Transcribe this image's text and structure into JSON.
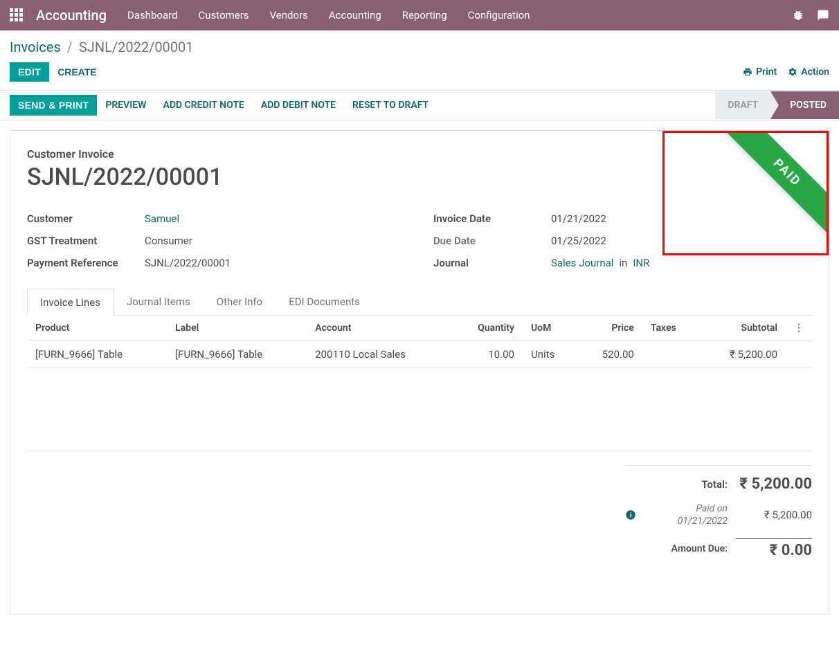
{
  "topnav": {
    "app_title": "Accounting",
    "items": [
      "Dashboard",
      "Customers",
      "Vendors",
      "Accounting",
      "Reporting",
      "Configuration"
    ]
  },
  "breadcrumb": {
    "root": "Invoices",
    "current": "SJNL/2022/00001"
  },
  "controls": {
    "edit": "Edit",
    "create": "Create",
    "print": "Print",
    "action": "Action"
  },
  "strip": {
    "send_print": "Send & Print",
    "preview": "Preview",
    "credit": "Add Credit Note",
    "debit": "Add Debit Note",
    "reset": "Reset to Draft"
  },
  "status": {
    "draft": "DRAFT",
    "posted": "POSTED"
  },
  "ribbon": "PAID",
  "invoice": {
    "subtitle": "Customer Invoice",
    "title": "SJNL/2022/00001",
    "fields_left": {
      "customer_label": "Customer",
      "customer_value": "Samuel",
      "gst_label": "GST Treatment",
      "gst_value": "Consumer",
      "payref_label": "Payment Reference",
      "payref_value": "SJNL/2022/00001"
    },
    "fields_right": {
      "invdate_label": "Invoice Date",
      "invdate_value": "01/21/2022",
      "duedate_label": "Due Date",
      "duedate_value": "01/25/2022",
      "journal_label": "Journal",
      "journal_value": "Sales Journal",
      "journal_in": "in",
      "journal_cur": "INR"
    }
  },
  "tabs": [
    "Invoice Lines",
    "Journal Items",
    "Other Info",
    "EDI Documents"
  ],
  "table": {
    "headers": {
      "product": "Product",
      "label": "Label",
      "account": "Account",
      "quantity": "Quantity",
      "uom": "UoM",
      "price": "Price",
      "taxes": "Taxes",
      "subtotal": "Subtotal"
    },
    "rows": [
      {
        "product": "[FURN_9666] Table",
        "label": "[FURN_9666] Table",
        "account": "200110 Local Sales",
        "quantity": "10.00",
        "uom": "Units",
        "price": "520.00",
        "taxes": "",
        "subtotal": "₹ 5,200.00"
      }
    ]
  },
  "totals": {
    "total_label": "Total:",
    "total_value": "₹ 5,200.00",
    "paid_label_1": "Paid on",
    "paid_label_2": "01/21/2022",
    "paid_value": "₹ 5,200.00",
    "due_label": "Amount Due:",
    "due_value": "₹ 0.00"
  }
}
